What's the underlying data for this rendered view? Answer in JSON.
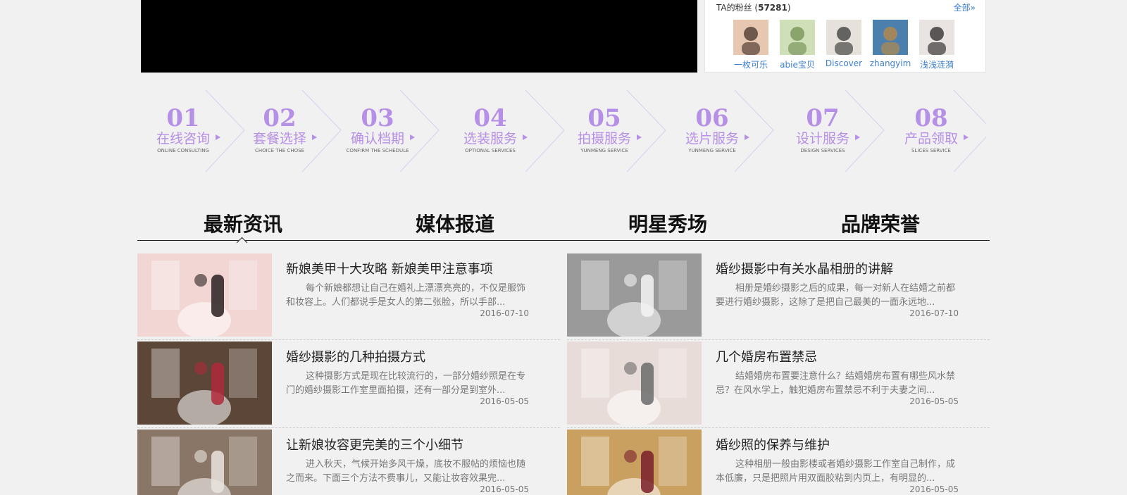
{
  "fans": {
    "label_prefix": "TA的粉丝 (",
    "count": "57281",
    "label_suffix": ")",
    "all_link": "全部»",
    "users": [
      {
        "name": "一枚可乐",
        "avatar_colors": [
          "#e8c7b0",
          "#3a2a22"
        ]
      },
      {
        "name": "abie宝贝",
        "avatar_colors": [
          "#cfe0b8",
          "#6c8a4c"
        ]
      },
      {
        "name": "Discover",
        "avatar_colors": [
          "#e6e1da",
          "#2d2d2d"
        ]
      },
      {
        "name": "zhangyim",
        "avatar_colors": [
          "#4a7fae",
          "#c68a3a"
        ]
      },
      {
        "name": "浅浅涟漪",
        "avatar_colors": [
          "#e9e4e1",
          "#1d1a1a"
        ]
      }
    ]
  },
  "steps": [
    {
      "num": "01",
      "cn": "在线咨询",
      "en": "ONLINE CONSULTING"
    },
    {
      "num": "02",
      "cn": "套餐选择",
      "en": "CHOICE THE CHOSE"
    },
    {
      "num": "03",
      "cn": "确认档期",
      "en": "CONFIRM THE SCHEDULE"
    },
    {
      "num": "04",
      "cn": "选装服务",
      "en": "OPTIONAL SERVICES"
    },
    {
      "num": "05",
      "cn": "拍摄服务",
      "en": "YUNMENG SERVICE"
    },
    {
      "num": "06",
      "cn": "选片服务",
      "en": "YUNMENG SERVICE"
    },
    {
      "num": "07",
      "cn": "设计服务",
      "en": "DESIGN SERVICES"
    },
    {
      "num": "08",
      "cn": "产品领取",
      "en": "SLICES SERVICE"
    }
  ],
  "tabs": [
    "最新资讯",
    "媒体报道",
    "明星秀场",
    "品牌荣誉"
  ],
  "news_left": [
    {
      "title": "新娘美甲十大攻略 新娘美甲注意事项",
      "desc": "每个新娘都想让自己在婚礼上漂漂亮亮的，不仅是服饰和妆容上。人们都说手是女人的第二张脸，所以手部...",
      "date": "2016-07-10",
      "thumb": [
        "#f1d6d3",
        "#2a2020"
      ]
    },
    {
      "title": "婚纱摄影的几种拍摄方式",
      "desc": "这种摄影方式是现在比较流行的，一部分婚纱照是在专门的婚纱摄影工作室里面拍摄，还有一部分是到室外...",
      "date": "2016-05-05",
      "thumb": [
        "#5b4638",
        "#b02a3a"
      ]
    },
    {
      "title": "让新娘妆容更完美的三个小细节",
      "desc": "进入秋天，气候开始多风干燥，底妆不服帖的烦恼也随之而来。下面三个方法不费事儿，又能让妆容效果完...",
      "date": "2016-05-05",
      "thumb": [
        "#8a7666",
        "#e9e4de"
      ]
    }
  ],
  "news_right": [
    {
      "title": "婚纱摄影中有关水晶相册的讲解",
      "desc": "相册是婚纱摄影之后的成果，每一对新人在结婚之前都要进行婚纱摄影，这除了是把自己最美的一面永远地...",
      "date": "2016-07-10",
      "thumb": [
        "#9a9a9a",
        "#f4f4f4"
      ]
    },
    {
      "title": "几个婚房布置禁忌",
      "desc": "结婚婚房布置要注意什么？结婚婚房布置有哪些风水禁忌？在风水学上，触犯婚房布置禁忌不利于夫妻之间...",
      "date": "2016-05-05",
      "thumb": [
        "#e8dcd8",
        "#6b6b6b"
      ]
    },
    {
      "title": "婚纱照的保养与维护",
      "desc": "这种相册一般由影楼或者婚纱摄影工作室自己制作，成本低廉，只是把照片用双面胶粘到内页上，有明显的...",
      "date": "2016-05-05",
      "thumb": [
        "#c9a060",
        "#7a1f2c"
      ]
    }
  ]
}
